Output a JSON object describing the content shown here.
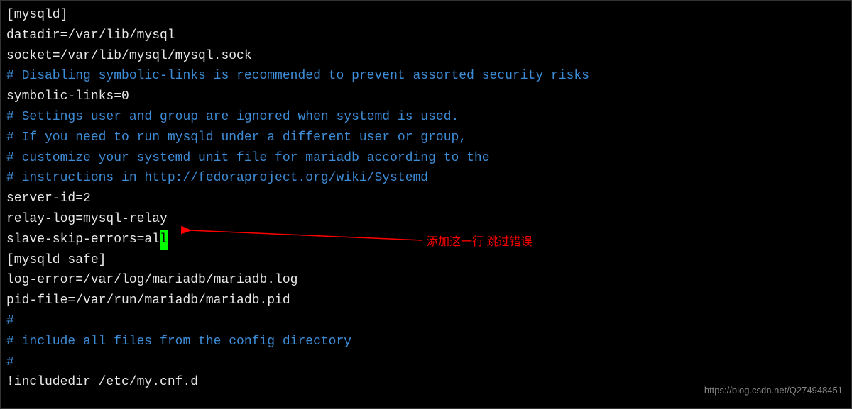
{
  "config": {
    "section_mysqld": "[mysqld]",
    "datadir": "datadir=/var/lib/mysql",
    "socket": "socket=/var/lib/mysql/mysql.sock",
    "comment_symbolic": "# Disabling symbolic-links is recommended to prevent assorted security risks",
    "symbolic_links": "symbolic-links=0",
    "comment_settings": "# Settings user and group are ignored when systemd is used.",
    "comment_ifyou": "# If you need to run mysqld under a different user or group,",
    "comment_customize": "# customize your systemd unit file for mariadb according to the",
    "comment_instructions": "# instructions in http://fedoraproject.org/wiki/Systemd",
    "server_id": "server-id=2",
    "relay_log": "relay-log=mysql-relay",
    "slave_skip_prefix": "slave-skip-errors=al",
    "slave_skip_cursor": "l",
    "section_mysqld_safe": "[mysqld_safe]",
    "log_error": "log-error=/var/log/mariadb/mariadb.log",
    "pid_file": "pid-file=/var/run/mariadb/mariadb.pid",
    "empty1": "",
    "hash1": "#",
    "comment_include": "# include all files from the config directory",
    "hash2": "#",
    "includedir": "!includedir /etc/my.cnf.d"
  },
  "annotation_text": "添加这一行 跳过错误",
  "watermark": "https://blog.csdn.net/Q274948451"
}
